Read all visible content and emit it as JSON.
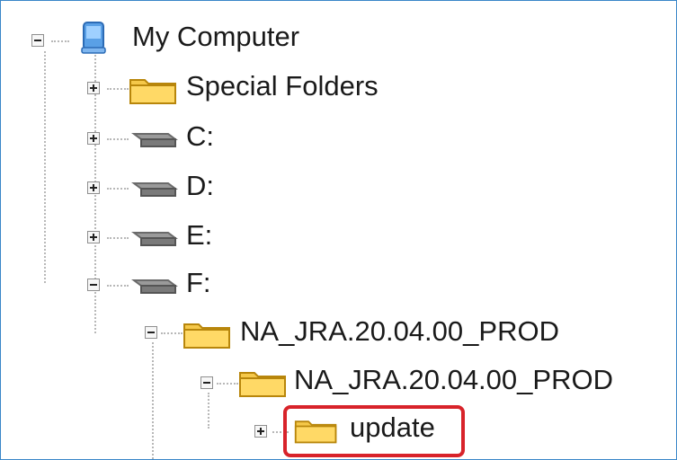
{
  "tree": {
    "root": {
      "label": "My Computer",
      "icon": "computer-icon",
      "expanded": true
    },
    "items": [
      {
        "label": "Special Folders",
        "icon": "folder-icon",
        "expanded": false
      },
      {
        "label": "C:",
        "icon": "drive-icon",
        "expanded": false
      },
      {
        "label": "D:",
        "icon": "drive-icon",
        "expanded": false
      },
      {
        "label": "E:",
        "icon": "drive-icon",
        "expanded": false
      },
      {
        "label": "F:",
        "icon": "drive-icon",
        "expanded": true
      },
      {
        "label": "NA_JRA.20.04.00_PROD",
        "icon": "folder-icon",
        "expanded": true
      },
      {
        "label": "NA_JRA.20.04.00_PROD",
        "icon": "folder-icon",
        "expanded": true
      },
      {
        "label": "update",
        "icon": "folder-icon",
        "expanded": false,
        "highlighted": true
      }
    ]
  },
  "colors": {
    "frame_border": "#3a86c8",
    "highlight_border": "#d8232a",
    "folder_fill": "#f5c84a"
  }
}
